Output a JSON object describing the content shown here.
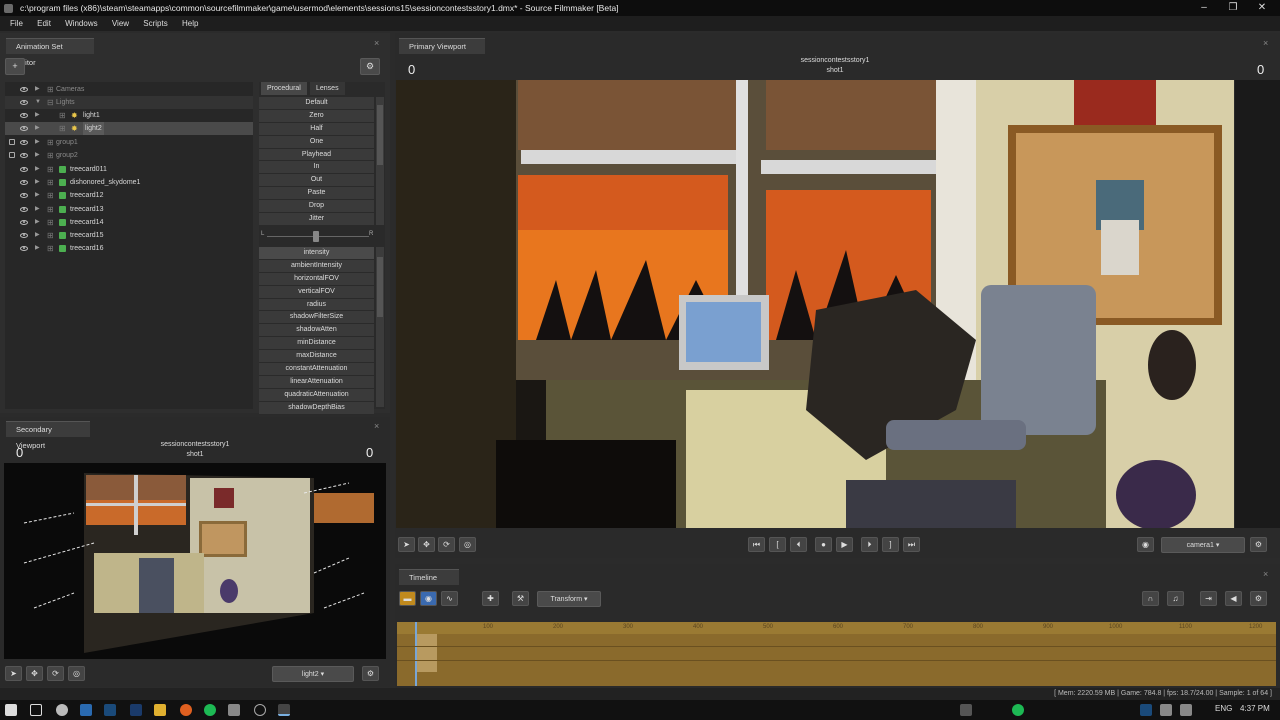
{
  "window": {
    "title": "c:\\program files (x86)\\steam\\steamapps\\common\\sourcefilmmaker\\game\\usermod\\elements\\sessions15\\sessioncontestsstory1.dmx* - Source Filmmaker [Beta]"
  },
  "menu": [
    "File",
    "Edit",
    "Windows",
    "View",
    "Scripts",
    "Help"
  ],
  "animation_set_editor": {
    "tab_label": "Animation Set Editor",
    "add_button": "+",
    "tree": [
      {
        "label": "Cameras",
        "dim": true
      },
      {
        "label": "Lights",
        "dim": true
      },
      {
        "label": "light1",
        "dim": false
      },
      {
        "label": "light2",
        "dim": false
      },
      {
        "label": "group1",
        "dim": true
      },
      {
        "label": "group2",
        "dim": true
      },
      {
        "label": "treecard011",
        "dim": false
      },
      {
        "label": "dishonored_skydome1",
        "dim": false
      },
      {
        "label": "treecard12",
        "dim": false
      },
      {
        "label": "treecard13",
        "dim": false
      },
      {
        "label": "treecard14",
        "dim": false
      },
      {
        "label": "treecard15",
        "dim": false
      },
      {
        "label": "treecard16",
        "dim": false
      }
    ],
    "proc_tabs": [
      "Procedural",
      "Lenses"
    ],
    "procedural": [
      "Default",
      "Zero",
      "Half",
      "One",
      "Playhead",
      "In",
      "Out",
      "Paste",
      "Drop",
      "Jitter"
    ],
    "slider_left": "L",
    "slider_right": "R",
    "properties": [
      "intensity",
      "ambientIntensity",
      "horizontalFOV",
      "verticalFOV",
      "radius",
      "shadowFilterSize",
      "shadowAtten",
      "minDistance",
      "maxDistance",
      "constantAttenuation",
      "linearAttenuation",
      "quadraticAttenuation",
      "shadowDepthBias"
    ]
  },
  "secondary_viewport": {
    "tab_label": "Secondary Viewport",
    "session": "sessioncontestsstory1",
    "shot": "shot1",
    "frame_left": "0",
    "frame_right": "0",
    "dropdown": "light2"
  },
  "primary_viewport": {
    "tab_label": "Primary Viewport",
    "session": "sessioncontestsstory1",
    "shot": "shot1",
    "frame_left": "0",
    "frame_right": "0",
    "camera_dropdown": "camera1"
  },
  "timeline": {
    "tab_label": "Timeline",
    "mode_dropdown": "Transform",
    "ticks": [
      "100",
      "200",
      "300",
      "400",
      "500",
      "600",
      "700",
      "800",
      "900",
      "1000",
      "1100",
      "1200"
    ]
  },
  "status": {
    "text": "[ Mem: 2220.59 MB | Game: 784.8 | fps: 18.7/24.00 | Sample: 1 of 64 ]"
  },
  "taskbar": {
    "lang": "ENG",
    "time": "4:37 PM"
  }
}
